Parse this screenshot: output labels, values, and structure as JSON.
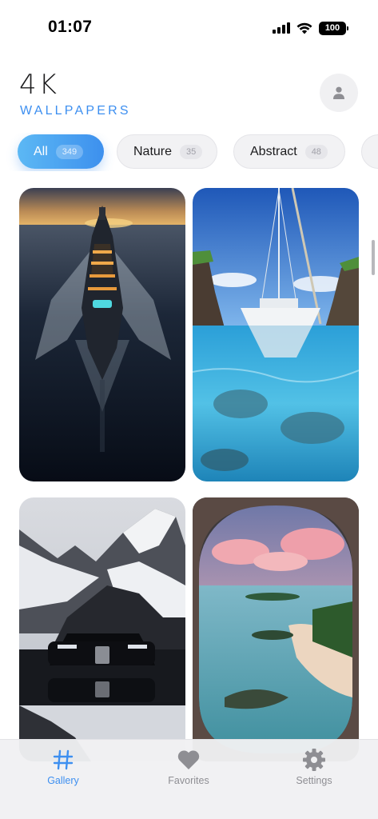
{
  "status_bar": {
    "time": "01:07",
    "battery": "100"
  },
  "header": {
    "title": "4K",
    "subtitle": "WALLPAPERS",
    "profile_icon": "person-icon"
  },
  "categories": [
    {
      "label": "All",
      "count": "349",
      "active": true
    },
    {
      "label": "Nature",
      "count": "35",
      "active": false
    },
    {
      "label": "Abstract",
      "count": "48",
      "active": false
    },
    {
      "label": "",
      "count": "",
      "active": false
    }
  ],
  "gallery": [
    {
      "subject": "yacht"
    },
    {
      "subject": "sailboat"
    },
    {
      "subject": "car"
    },
    {
      "subject": "island"
    }
  ],
  "tabs": [
    {
      "label": "Gallery",
      "icon": "hashtag-icon",
      "active": true
    },
    {
      "label": "Favorites",
      "icon": "heart-icon",
      "active": false
    },
    {
      "label": "Settings",
      "icon": "gear-icon",
      "active": false
    }
  ],
  "colors": {
    "accent": "#3d8ff0",
    "inactive": "#8e8e93"
  }
}
